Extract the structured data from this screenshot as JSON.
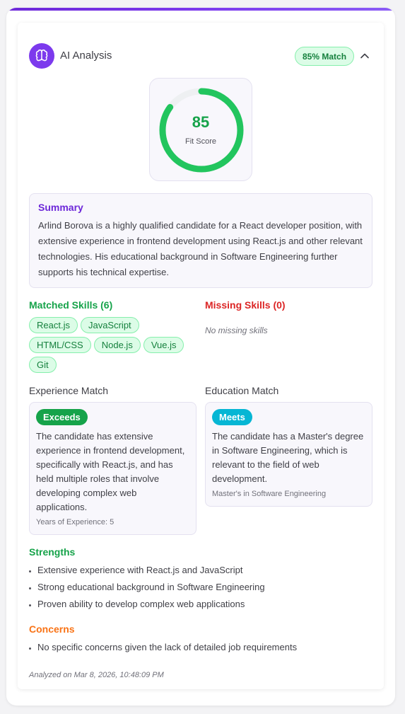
{
  "header": {
    "title": "AI Analysis",
    "match_badge": "85% Match"
  },
  "score": {
    "value": "85",
    "fraction": 0.85,
    "label": "Fit Score",
    "color": "#22c55e"
  },
  "summary": {
    "title": "Summary",
    "text": "Arlind Borova is a highly qualified candidate for a React developer position, with extensive experience in frontend development using React.js and other relevant technologies. His educational background in Software Engineering further supports his technical expertise."
  },
  "skills": {
    "matched_title": "Matched Skills (6)",
    "matched": [
      "React.js",
      "JavaScript",
      "HTML/CSS",
      "Node.js",
      "Vue.js",
      "Git"
    ],
    "missing_title": "Missing Skills (0)",
    "missing_empty": "No missing skills"
  },
  "experience": {
    "title": "Experience Match",
    "badge": "Exceeds",
    "badge_color": "#16a34a",
    "text": "The candidate has extensive experience in frontend development, specifically with React.js, and has held multiple roles that involve developing complex web applications.",
    "meta": "Years of Experience: 5"
  },
  "education": {
    "title": "Education Match",
    "badge": "Meets",
    "badge_color": "#06b6d4",
    "text": "The candidate has a Master's degree in Software Engineering, which is relevant to the field of web development.",
    "meta": "Master's in Software Engineering"
  },
  "strengths": {
    "title": "Strengths",
    "items": [
      "Extensive experience with React.js and JavaScript",
      "Strong educational background in Software Engineering",
      "Proven ability to develop complex web applications"
    ]
  },
  "concerns": {
    "title": "Concerns",
    "items": [
      "No specific concerns given the lack of detailed job requirements"
    ]
  },
  "footer": {
    "analyzed": "Analyzed on Mar 8, 2026, 10:48:09 PM"
  },
  "icons": {
    "header": "brain-icon",
    "collapse": "chevron-up-icon"
  }
}
